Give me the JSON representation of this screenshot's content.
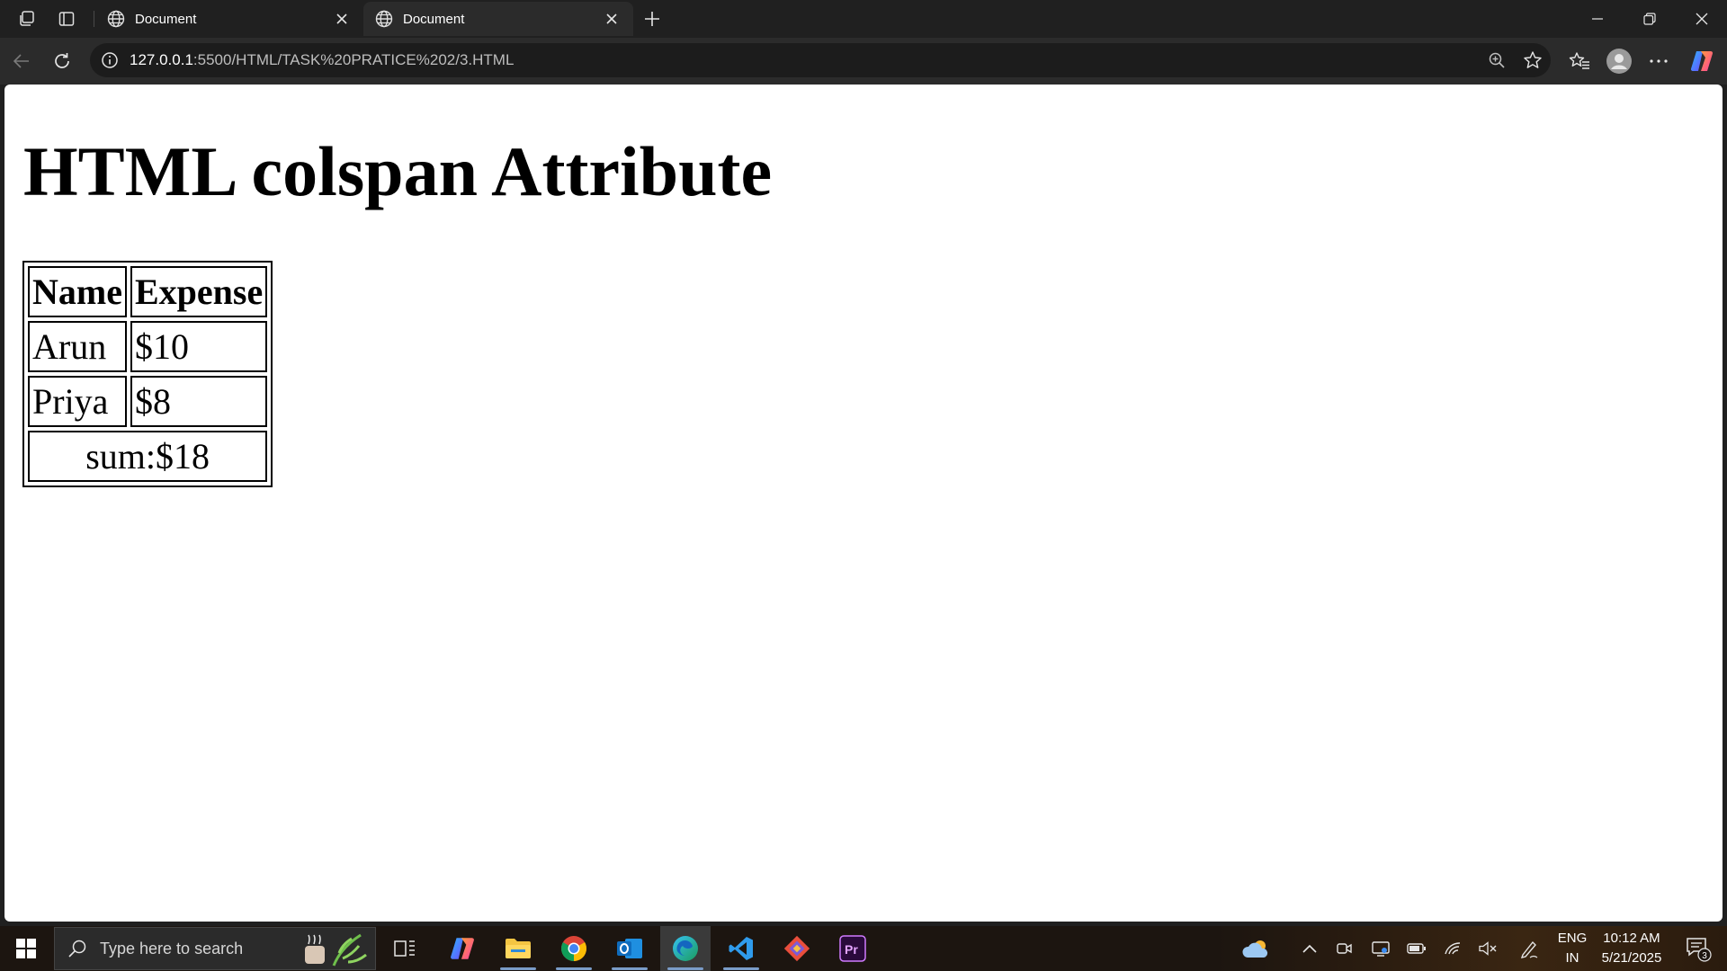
{
  "browser": {
    "tabs": [
      {
        "title": "Document",
        "active": false
      },
      {
        "title": "Document",
        "active": true
      }
    ],
    "url": {
      "host": "127.0.0.1",
      "rest": ":5500/HTML/TASK%20PRATICE%202/3.HTML"
    }
  },
  "page": {
    "heading": "HTML colspan Attribute",
    "table": {
      "headers": [
        "Name",
        "Expense"
      ],
      "rows": [
        [
          "Arun",
          "$10"
        ],
        [
          "Priya",
          "$8"
        ]
      ],
      "footer": "sum:$18"
    }
  },
  "taskbar": {
    "search_placeholder": "Type here to search",
    "language": {
      "line1": "ENG",
      "line2": "IN"
    },
    "clock": {
      "time": "10:12 AM",
      "date": "5/21/2025"
    },
    "notification_count": "3"
  },
  "colors": {
    "chrome_bg": "#202020",
    "toolbar_bg": "#2b2b2b",
    "page_bg": "#ffffff",
    "taskbar_bg": "#1c1510"
  }
}
